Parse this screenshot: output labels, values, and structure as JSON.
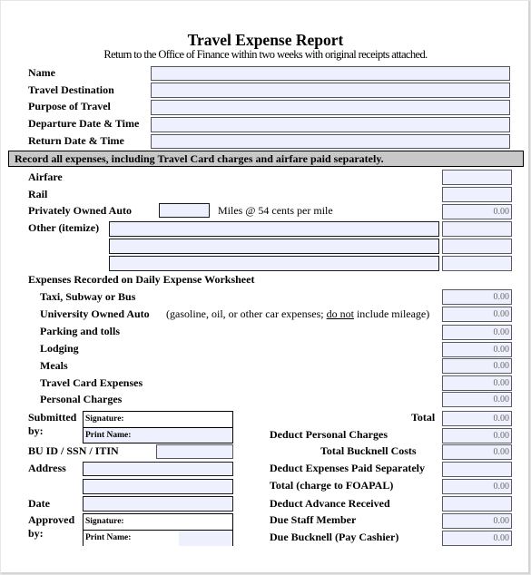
{
  "header": {
    "title": "Travel Expense Report",
    "subtitle": "Return to the Office of Finance within two weeks with original receipts attached."
  },
  "traveler_info": [
    {
      "label": "Name",
      "value": ""
    },
    {
      "label": "Travel Destination",
      "value": ""
    },
    {
      "label": "Purpose of Travel",
      "value": ""
    },
    {
      "label": "Departure Date & Time",
      "value": ""
    },
    {
      "label": "Return Date & Time",
      "value": ""
    }
  ],
  "banner": "Record all expenses, including Travel Card charges and airfare paid separately.",
  "transport": {
    "airfare": {
      "label": "Airfare",
      "amount": ""
    },
    "rail": {
      "label": "Rail",
      "amount": ""
    },
    "auto": {
      "label": "Privately Owned Auto",
      "miles": "",
      "rate_text": "Miles @ 54 cents per mile",
      "amount": "0.00"
    },
    "other": {
      "label": "Other (itemize)",
      "items": [
        {
          "description": "",
          "amount": ""
        },
        {
          "description": "",
          "amount": ""
        },
        {
          "description": "",
          "amount": ""
        }
      ]
    }
  },
  "worksheet": {
    "heading": "Expenses Recorded on Daily Expense Worksheet",
    "items": [
      {
        "label": "Taxi, Subway or Bus",
        "amount": "0.00"
      },
      {
        "label": "University Owned Auto",
        "amount": "0.00"
      },
      {
        "label": "Parking and tolls",
        "amount": "0.00"
      },
      {
        "label": "Lodging",
        "amount": "0.00"
      },
      {
        "label": "Meals",
        "amount": "0.00"
      },
      {
        "label": "Travel Card Expenses",
        "amount": "0.00"
      },
      {
        "label": "Personal Charges",
        "amount": "0.00"
      }
    ],
    "uoa_note_pre": "(gasoline, oil, or other car expenses; ",
    "uoa_note_underline": "do not",
    "uoa_note_post": " include mileage)"
  },
  "submitter": {
    "submitted_label": "Submitted",
    "by_label": "by:",
    "signature_label": "Signature:",
    "print_name_label": "Print Name:",
    "id_label": "BU ID / SSN / ITIN",
    "id_value": "",
    "address_label": "Address",
    "address_line1": "",
    "address_line2": "",
    "date_label": "Date",
    "date_value": "",
    "approved_label": "Approved",
    "approved_by_label": "by:"
  },
  "totals": [
    {
      "label": "Total",
      "amount": "0.00"
    },
    {
      "label": "Deduct Personal Charges",
      "amount": "0.00"
    },
    {
      "label": "Total Bucknell Costs",
      "amount": "0.00"
    },
    {
      "label": "Deduct Expenses Paid Separately",
      "amount": ""
    },
    {
      "label": "Total (charge to FOAPAL)",
      "amount": "0.00"
    },
    {
      "label": "Deduct Advance Received",
      "amount": ""
    },
    {
      "label": "Due Staff Member",
      "amount": "0.00"
    },
    {
      "label": "Due Bucknell (Pay Cashier)",
      "amount": "0.00"
    }
  ]
}
